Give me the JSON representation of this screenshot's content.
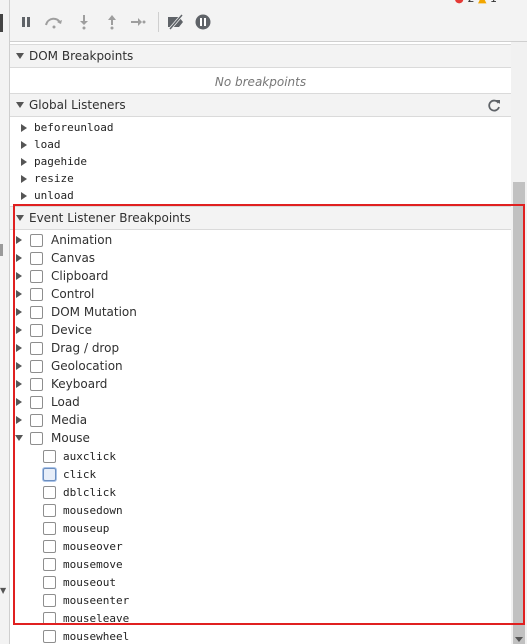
{
  "status": {
    "errors": "2",
    "warnings": "1"
  },
  "toolbar": {
    "icons": [
      "toggle-panel-icon",
      "pause-icon",
      "step-over-icon",
      "step-into-icon",
      "step-out-icon",
      "step-icon",
      "deactivate-breakpoints-icon",
      "pause-on-exceptions-icon"
    ]
  },
  "dom_breakpoints": {
    "title": "DOM Breakpoints",
    "empty_message": "No breakpoints"
  },
  "global_listeners": {
    "title": "Global Listeners",
    "items": [
      "beforeunload",
      "load",
      "pagehide",
      "resize",
      "unload"
    ]
  },
  "event_listener_breakpoints": {
    "title": "Event Listener Breakpoints",
    "categories": [
      "Animation",
      "Canvas",
      "Clipboard",
      "Control",
      "DOM Mutation",
      "Device",
      "Drag / drop",
      "Geolocation",
      "Keyboard",
      "Load",
      "Media",
      "Mouse"
    ],
    "mouse_events": [
      "auxclick",
      "click",
      "dblclick",
      "mousedown",
      "mouseup",
      "mouseover",
      "mousemove",
      "mouseout",
      "mouseenter",
      "mouseleave",
      "mousewheel"
    ]
  },
  "colors": {
    "highlight": "#e02020",
    "panel_bg": "#f3f3f3",
    "error": "#e53935",
    "warning": "#f2a600"
  }
}
